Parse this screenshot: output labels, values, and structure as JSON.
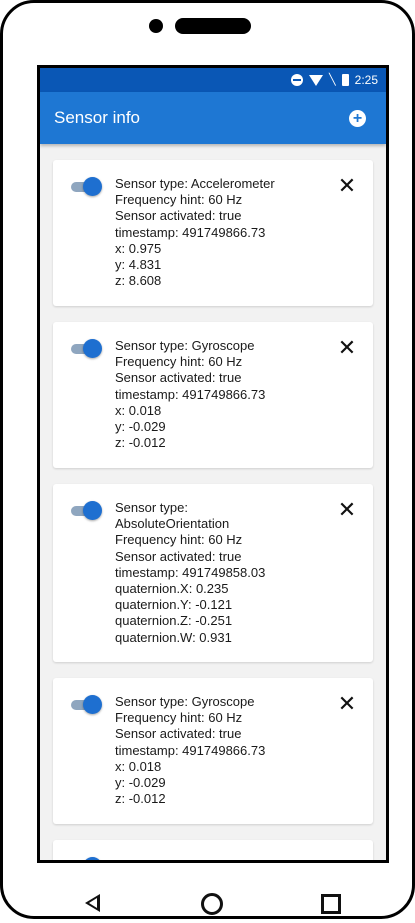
{
  "status_bar": {
    "time": "2:25",
    "icons": [
      "do-not-disturb-icon",
      "wifi-icon",
      "no-signal-icon",
      "battery-icon"
    ]
  },
  "toolbar": {
    "title": "Sensor info",
    "add_icon": "add-circle-icon"
  },
  "cards": [
    {
      "switch_on": true,
      "lines": [
        "Sensor type: Accelerometer",
        "Frequency hint: 60 Hz",
        "Sensor activated: true",
        "timestamp: 491749866.73",
        "x: 0.975",
        "y: 4.831",
        "z: 8.608"
      ]
    },
    {
      "switch_on": true,
      "lines": [
        "Sensor type: Gyroscope",
        "Frequency hint: 60 Hz",
        "Sensor activated: true",
        "timestamp: 491749866.73",
        "x: 0.018",
        "y: -0.029",
        "z: -0.012"
      ]
    },
    {
      "switch_on": true,
      "lines": [
        "Sensor type:",
        "AbsoluteOrientation",
        "Frequency hint: 60 Hz",
        "Sensor activated: true",
        "timestamp: 491749858.03",
        "quaternion.X: 0.235",
        "quaternion.Y: -0.121",
        "quaternion.Z: -0.251",
        "quaternion.W: 0.931"
      ]
    },
    {
      "switch_on": true,
      "lines": [
        "Sensor type: Gyroscope",
        "Frequency hint: 60 Hz",
        "Sensor activated: true",
        "timestamp: 491749866.73",
        "x: 0.018",
        "y: -0.029",
        "z: -0.012"
      ]
    },
    {
      "switch_on": true,
      "lines": []
    }
  ],
  "colors": {
    "status_bar": "#0a57b5",
    "toolbar": "#1e77d3",
    "switch_thumb": "#1e6fd0",
    "background": "#f2f2f2"
  },
  "nav_bar": {
    "icons": [
      "back-icon",
      "home-icon",
      "recent-apps-icon"
    ]
  }
}
